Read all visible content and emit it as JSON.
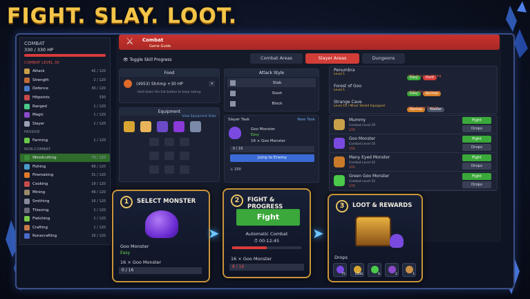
{
  "headline": "FIGHT. SLAY. LOOT.",
  "sidebar": {
    "title": "COMBAT",
    "hp": "330 / 330 HP",
    "combat_level": "COMBAT LEVEL 30",
    "passive": "PASSIVE",
    "non_combat": "NON-COMBAT",
    "combat_skills": [
      {
        "name": "Attack",
        "level": "42 / 120",
        "color": "#c9a04a"
      },
      {
        "name": "Strength",
        "level": "2 / 120",
        "color": "#c06a3a"
      },
      {
        "name": "Defence",
        "level": "30 / 120",
        "color": "#4a7ac9"
      },
      {
        "name": "Hitpoints",
        "level": "330",
        "color": "#c94a4a"
      },
      {
        "name": "Ranged",
        "level": "1 / 120",
        "color": "#4ac98a"
      },
      {
        "name": "Magic",
        "level": "1 / 120",
        "color": "#8a4ac9"
      },
      {
        "name": "Slayer",
        "level": "1 / 120",
        "color": "#9aa1b5"
      }
    ],
    "passive_skills": [
      {
        "name": "Farming",
        "level": "1 / 120",
        "color": "#6ac94a"
      }
    ],
    "noncombat_skills": [
      {
        "name": "Woodcutting",
        "level": "79 / 120",
        "color": "#3a8a3a"
      },
      {
        "name": "Fishing",
        "level": "68 / 120",
        "color": "#4a9ac9"
      },
      {
        "name": "Firemaking",
        "level": "31 / 120",
        "color": "#e07a2a"
      },
      {
        "name": "Cooking",
        "level": "19 / 120",
        "color": "#c94a4a"
      },
      {
        "name": "Mining",
        "level": "49 / 120",
        "color": "#9a8a6a"
      },
      {
        "name": "Smithing",
        "level": "16 / 120",
        "color": "#8a8a9a"
      },
      {
        "name": "Thieving",
        "level": "1 / 120",
        "color": "#6a6a7a"
      },
      {
        "name": "Fletching",
        "level": "1 / 120",
        "color": "#7ac94a"
      },
      {
        "name": "Crafting",
        "level": "1 / 120",
        "color": "#c97a4a"
      },
      {
        "name": "Runecrafting",
        "level": "16 / 120",
        "color": "#4a6ac9"
      }
    ]
  },
  "header": {
    "title": "Combat",
    "subtitle": "Game Guide"
  },
  "toggle": "Toggle Skill Progress",
  "tabs": {
    "areas": "Combat Areas",
    "slayer": "Slayer Areas",
    "dungeons": "Dungeons"
  },
  "food": {
    "title": "Food",
    "item": "(4953) Shrimp +30 HP",
    "hint": "Hold down the Eat button to keep eating."
  },
  "equipment": {
    "title": "Equipment",
    "link": "View Equipment Stats"
  },
  "attack_style": {
    "title": "Attack Style",
    "options": [
      "Stab",
      "Slash",
      "Block"
    ]
  },
  "slayer_task": {
    "title": "Slayer Task",
    "new": "New Task",
    "monster": "Goo Monster",
    "difficulty": "Easy",
    "count": "16 × Goo Monster",
    "progress": "0 / 16",
    "jump": "Jump to Enemy",
    "coins": "150"
  },
  "areas": [
    {
      "name": "Penumbra",
      "level": "Level 1",
      "tags": [
        "Easy",
        "Hard"
      ],
      "effect": "-10% Accuracy Rating"
    },
    {
      "name": "Forest of Goo",
      "level": "Level 1",
      "tags": [
        "Easy",
        "Normal"
      ],
      "effect": "+10% Attack Interval"
    },
    {
      "name": "Strange Cave",
      "level": "Level 10 / Minor Shield Equipped",
      "tags": [
        "Normal",
        "Master"
      ],
      "effect": "-15% Global Evasion"
    }
  ],
  "monsters": [
    {
      "name": "Mummy",
      "level": "Combat Level 29",
      "coins": "270"
    },
    {
      "name": "Goo Monster",
      "level": "Combat Level 16",
      "coins": "150"
    },
    {
      "name": "Many Eyed Monster",
      "level": "Combat Level 42",
      "coins": "370"
    },
    {
      "name": "Green Goo Monster",
      "level": "Combat Level 32",
      "coins": "270"
    }
  ],
  "fight_label": "Fight",
  "drops_label": "Drops",
  "card1": {
    "num": "1",
    "title": "SELECT MONSTER",
    "monster": "Goo Monster",
    "difficulty": "Easy",
    "count": "16 × Goo Monster",
    "progress": "0 / 16"
  },
  "card2": {
    "num": "2",
    "title": "FIGHT & PROGRESS",
    "button": "Fight",
    "auto": "Automatic Combat",
    "time": "00:12:45",
    "count": "16 × Goo Monster",
    "progress": "8 / 16",
    "fill": 0.5
  },
  "card3": {
    "num": "3",
    "title": "LOOT & REWARDS",
    "drops": "Drops",
    "items": [
      {
        "q": "75",
        "c": "#7a4ae0"
      },
      {
        "q": "1200",
        "c": "#d9a532"
      },
      {
        "q": "6",
        "c": "#4ac94a"
      },
      {
        "q": "2",
        "c": "#8a4ac9"
      },
      {
        "q": "1",
        "c": "#c9904a"
      }
    ]
  }
}
